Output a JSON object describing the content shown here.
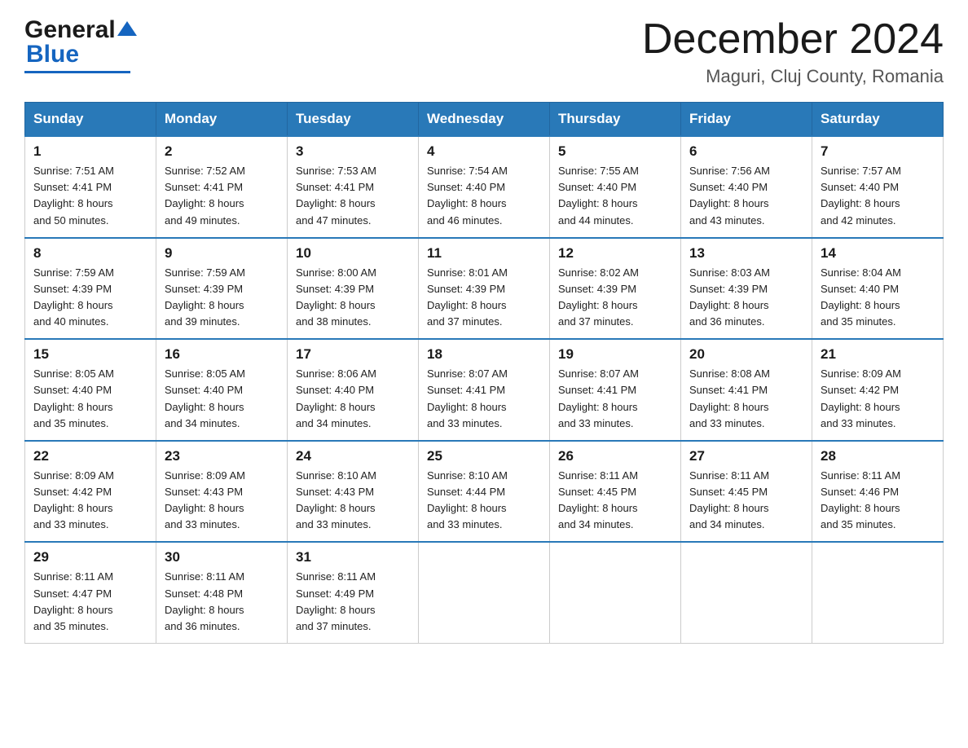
{
  "header": {
    "logo_general": "General",
    "logo_blue": "Blue",
    "month_year": "December 2024",
    "location": "Maguri, Cluj County, Romania"
  },
  "weekdays": [
    "Sunday",
    "Monday",
    "Tuesday",
    "Wednesday",
    "Thursday",
    "Friday",
    "Saturday"
  ],
  "weeks": [
    [
      {
        "day": "1",
        "sunrise": "7:51 AM",
        "sunset": "4:41 PM",
        "daylight": "8 hours and 50 minutes."
      },
      {
        "day": "2",
        "sunrise": "7:52 AM",
        "sunset": "4:41 PM",
        "daylight": "8 hours and 49 minutes."
      },
      {
        "day": "3",
        "sunrise": "7:53 AM",
        "sunset": "4:41 PM",
        "daylight": "8 hours and 47 minutes."
      },
      {
        "day": "4",
        "sunrise": "7:54 AM",
        "sunset": "4:40 PM",
        "daylight": "8 hours and 46 minutes."
      },
      {
        "day": "5",
        "sunrise": "7:55 AM",
        "sunset": "4:40 PM",
        "daylight": "8 hours and 44 minutes."
      },
      {
        "day": "6",
        "sunrise": "7:56 AM",
        "sunset": "4:40 PM",
        "daylight": "8 hours and 43 minutes."
      },
      {
        "day": "7",
        "sunrise": "7:57 AM",
        "sunset": "4:40 PM",
        "daylight": "8 hours and 42 minutes."
      }
    ],
    [
      {
        "day": "8",
        "sunrise": "7:59 AM",
        "sunset": "4:39 PM",
        "daylight": "8 hours and 40 minutes."
      },
      {
        "day": "9",
        "sunrise": "7:59 AM",
        "sunset": "4:39 PM",
        "daylight": "8 hours and 39 minutes."
      },
      {
        "day": "10",
        "sunrise": "8:00 AM",
        "sunset": "4:39 PM",
        "daylight": "8 hours and 38 minutes."
      },
      {
        "day": "11",
        "sunrise": "8:01 AM",
        "sunset": "4:39 PM",
        "daylight": "8 hours and 37 minutes."
      },
      {
        "day": "12",
        "sunrise": "8:02 AM",
        "sunset": "4:39 PM",
        "daylight": "8 hours and 37 minutes."
      },
      {
        "day": "13",
        "sunrise": "8:03 AM",
        "sunset": "4:39 PM",
        "daylight": "8 hours and 36 minutes."
      },
      {
        "day": "14",
        "sunrise": "8:04 AM",
        "sunset": "4:40 PM",
        "daylight": "8 hours and 35 minutes."
      }
    ],
    [
      {
        "day": "15",
        "sunrise": "8:05 AM",
        "sunset": "4:40 PM",
        "daylight": "8 hours and 35 minutes."
      },
      {
        "day": "16",
        "sunrise": "8:05 AM",
        "sunset": "4:40 PM",
        "daylight": "8 hours and 34 minutes."
      },
      {
        "day": "17",
        "sunrise": "8:06 AM",
        "sunset": "4:40 PM",
        "daylight": "8 hours and 34 minutes."
      },
      {
        "day": "18",
        "sunrise": "8:07 AM",
        "sunset": "4:41 PM",
        "daylight": "8 hours and 33 minutes."
      },
      {
        "day": "19",
        "sunrise": "8:07 AM",
        "sunset": "4:41 PM",
        "daylight": "8 hours and 33 minutes."
      },
      {
        "day": "20",
        "sunrise": "8:08 AM",
        "sunset": "4:41 PM",
        "daylight": "8 hours and 33 minutes."
      },
      {
        "day": "21",
        "sunrise": "8:09 AM",
        "sunset": "4:42 PM",
        "daylight": "8 hours and 33 minutes."
      }
    ],
    [
      {
        "day": "22",
        "sunrise": "8:09 AM",
        "sunset": "4:42 PM",
        "daylight": "8 hours and 33 minutes."
      },
      {
        "day": "23",
        "sunrise": "8:09 AM",
        "sunset": "4:43 PM",
        "daylight": "8 hours and 33 minutes."
      },
      {
        "day": "24",
        "sunrise": "8:10 AM",
        "sunset": "4:43 PM",
        "daylight": "8 hours and 33 minutes."
      },
      {
        "day": "25",
        "sunrise": "8:10 AM",
        "sunset": "4:44 PM",
        "daylight": "8 hours and 33 minutes."
      },
      {
        "day": "26",
        "sunrise": "8:11 AM",
        "sunset": "4:45 PM",
        "daylight": "8 hours and 34 minutes."
      },
      {
        "day": "27",
        "sunrise": "8:11 AM",
        "sunset": "4:45 PM",
        "daylight": "8 hours and 34 minutes."
      },
      {
        "day": "28",
        "sunrise": "8:11 AM",
        "sunset": "4:46 PM",
        "daylight": "8 hours and 35 minutes."
      }
    ],
    [
      {
        "day": "29",
        "sunrise": "8:11 AM",
        "sunset": "4:47 PM",
        "daylight": "8 hours and 35 minutes."
      },
      {
        "day": "30",
        "sunrise": "8:11 AM",
        "sunset": "4:48 PM",
        "daylight": "8 hours and 36 minutes."
      },
      {
        "day": "31",
        "sunrise": "8:11 AM",
        "sunset": "4:49 PM",
        "daylight": "8 hours and 37 minutes."
      },
      null,
      null,
      null,
      null
    ]
  ],
  "labels": {
    "sunrise": "Sunrise:",
    "sunset": "Sunset:",
    "daylight": "Daylight:"
  }
}
